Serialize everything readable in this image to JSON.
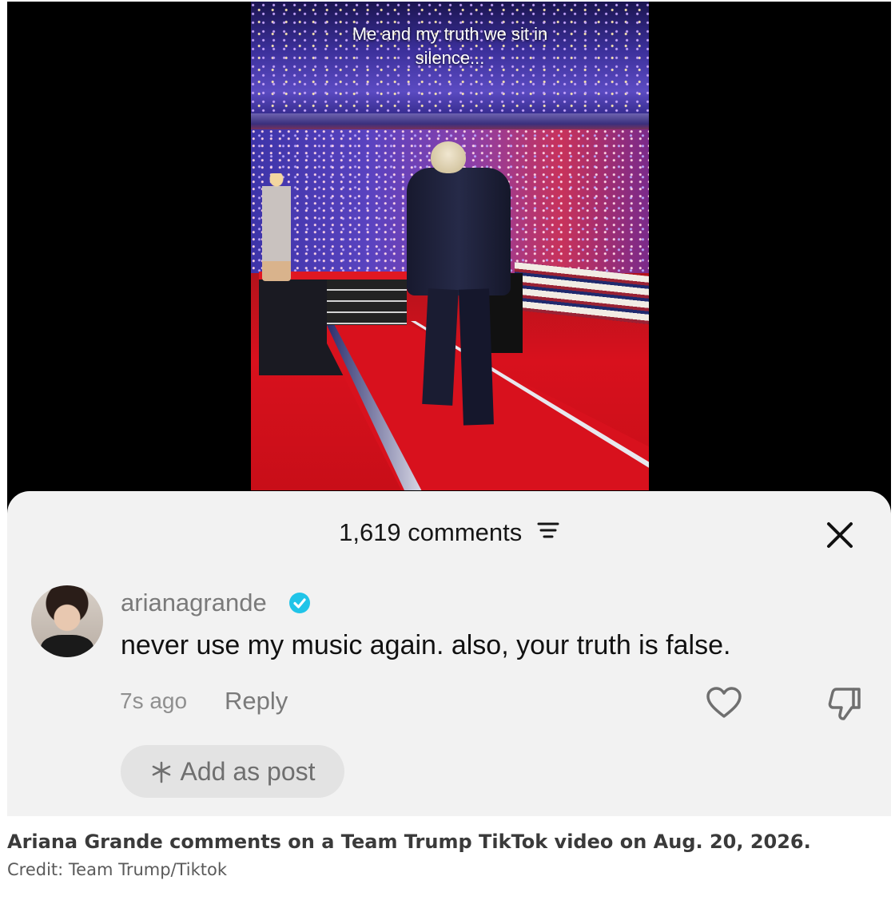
{
  "video": {
    "caption_line1": "Me and my truth we sit in",
    "caption_line2": "silence..."
  },
  "comments": {
    "count_label": "1,619 comments",
    "filter_icon": "filter-icon",
    "close_icon": "close-icon",
    "items": [
      {
        "username": "arianagrande",
        "verified": true,
        "text": "never use my music again. also, your truth is false.",
        "time": "7s ago",
        "reply_label": "Reply",
        "like_icon": "heart-icon",
        "dislike_icon": "thumbs-down-icon"
      }
    ],
    "add_as_post_label": "Add as post"
  },
  "article": {
    "caption": "Ariana Grande comments on a Team Trump TikTok video on Aug. 20, 2026.",
    "credit": "Credit: Team Trump/Tiktok"
  },
  "colors": {
    "verified_badge": "#20c4e8",
    "sheet_background": "#f2f2f2",
    "pill_background": "#e3e3e3"
  }
}
